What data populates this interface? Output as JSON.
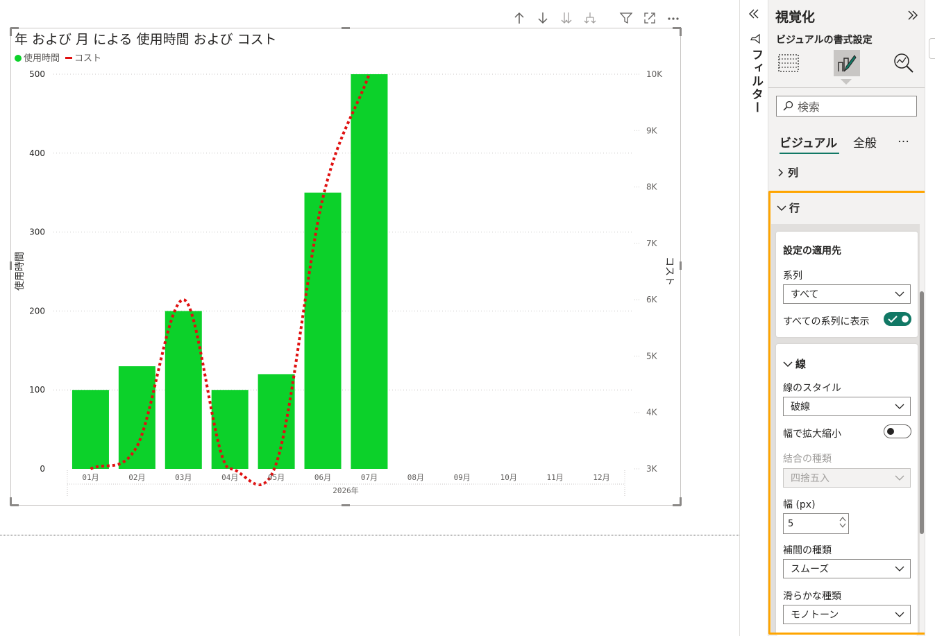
{
  "toolbar": {
    "icons": [
      "arrow-up-icon",
      "arrow-down-icon",
      "expand-all-down-icon",
      "drill-down-icon",
      "filter-icon",
      "focus-mode-icon",
      "more-options-icon"
    ]
  },
  "chart": {
    "title": "年 および 月 による 使用時間 および コスト",
    "legend": [
      {
        "label": "使用時間",
        "color": "#0cd12a",
        "marker": "dot"
      },
      {
        "label": "コスト",
        "color": "#e01010",
        "marker": "line"
      }
    ],
    "y_left_label": "使用時間",
    "y_right_label": "コスト",
    "x_group_label": "2026年"
  },
  "chart_data": {
    "type": "bar",
    "categories": [
      "01月",
      "02月",
      "03月",
      "04月",
      "05月",
      "06月",
      "07月",
      "08月",
      "09月",
      "10月",
      "11月",
      "12月"
    ],
    "series": [
      {
        "name": "使用時間",
        "type": "bar",
        "axis": "left",
        "color": "#0cd12a",
        "values": [
          100,
          130,
          200,
          100,
          120,
          350,
          500,
          null,
          null,
          null,
          null,
          null
        ]
      },
      {
        "name": "コスト",
        "type": "line",
        "axis": "right",
        "color": "#e01010",
        "style": "dotted",
        "interpolation": "smooth",
        "values": [
          3000,
          3400,
          6000,
          3000,
          3100,
          7800,
          10000,
          null,
          null,
          null,
          null,
          null
        ]
      }
    ],
    "title": "年 および 月 による 使用時間 および コスト",
    "xlabel": "2026年",
    "ylabel": "使用時間",
    "y2label": "コスト",
    "ylim": [
      0,
      500
    ],
    "y2lim": [
      3000,
      10000
    ],
    "y_ticks": [
      "0",
      "100",
      "200",
      "300",
      "400",
      "500"
    ],
    "y2_ticks": [
      "3K",
      "4K",
      "5K",
      "6K",
      "7K",
      "8K",
      "9K",
      "10K"
    ],
    "grid": true,
    "legend_position": "top-left"
  },
  "filter_pane": {
    "label": "フィルター",
    "collapse_icon": "double-chevron-left-icon",
    "filter_icon": "filter-icon"
  },
  "viz_pane": {
    "title": "視覚化",
    "expand_icon": "double-chevron-right-icon",
    "subtitle": "ビジュアルの書式設定",
    "mode_icons": [
      "build-visual-icon",
      "format-visual-icon",
      "analytics-icon"
    ],
    "search_placeholder": "検索",
    "tabs": [
      "ビジュアル",
      "全般"
    ],
    "active_tab": "ビジュアル",
    "more_label": "…",
    "sections": {
      "columns": "列",
      "rows": "行"
    },
    "apply_card": {
      "heading": "設定の適用先",
      "series_label": "系列",
      "series_value": "すべて",
      "show_all_label": "すべての系列に表示",
      "show_all_on": true
    },
    "line_card": {
      "heading": "線",
      "style_label": "線のスタイル",
      "style_value": "破線",
      "scale_label": "幅で拡大縮小",
      "scale_on": false,
      "join_label": "結合の種類",
      "join_value": "四捨五入",
      "width_label": "幅 (px)",
      "width_value": "5",
      "interp_label": "補間の種類",
      "interp_value": "スムーズ",
      "smooth_label": "滑らかな種類",
      "smooth_value": "モノトーン"
    },
    "highlight_color": "#ffa500",
    "accent_color": "#117865"
  }
}
